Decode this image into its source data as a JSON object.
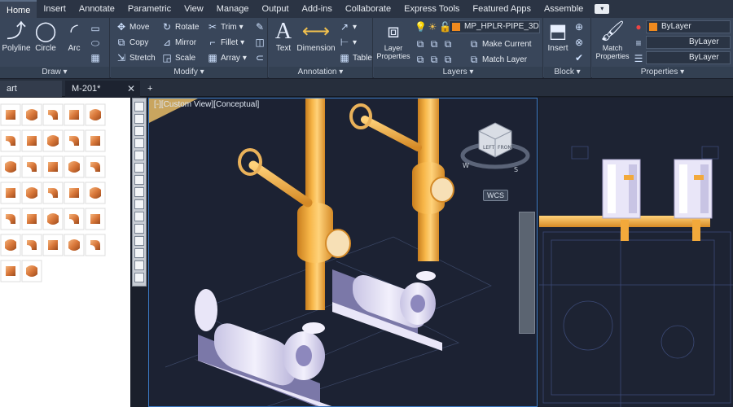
{
  "menu": {
    "items": [
      "Home",
      "Insert",
      "Annotate",
      "Parametric",
      "View",
      "Manage",
      "Output",
      "Add-ins",
      "Collaborate",
      "Express Tools",
      "Featured Apps",
      "Assemble"
    ],
    "active": "Home"
  },
  "ribbon": {
    "draw": {
      "title": "Draw",
      "polyline": "Polyline",
      "circle": "Circle",
      "arc": "Arc"
    },
    "modify": {
      "title": "Modify",
      "move": "Move",
      "rotate": "Rotate",
      "trim": "Trim",
      "copy": "Copy",
      "mirror": "Mirror",
      "fillet": "Fillet",
      "stretch": "Stretch",
      "scale": "Scale",
      "array": "Array"
    },
    "annotation": {
      "title": "Annotation",
      "text": "Text",
      "dimension": "Dimension",
      "table": "Table"
    },
    "layers": {
      "title": "Layers",
      "layer_properties": "Layer Properties",
      "current_layer": "MP_HPLR-PIPE_3D",
      "make_current": "Make Current",
      "match_layer": "Match Layer",
      "layer_color": "#f08a1e"
    },
    "block": {
      "title": "Block",
      "insert": "Insert"
    },
    "properties": {
      "title": "Properties",
      "match_properties": "Match Properties",
      "color": "ByLayer",
      "linetype": "ByLayer",
      "lineweight": "ByLayer",
      "color_swatch": "#f08a1e"
    }
  },
  "tabs": [
    {
      "label": "art",
      "active": false
    },
    {
      "label": "M-201*",
      "active": true
    }
  ],
  "viewport": {
    "label": "[-][Custom View][Conceptual]",
    "wcs": "WCS",
    "viewcube": {
      "left": "LEFT",
      "front": "FRONT",
      "w": "W",
      "s": "S"
    }
  },
  "colors": {
    "pipe": "#f2a93b",
    "equipment": "#e9e6f8",
    "accent": "#3b79c2"
  }
}
